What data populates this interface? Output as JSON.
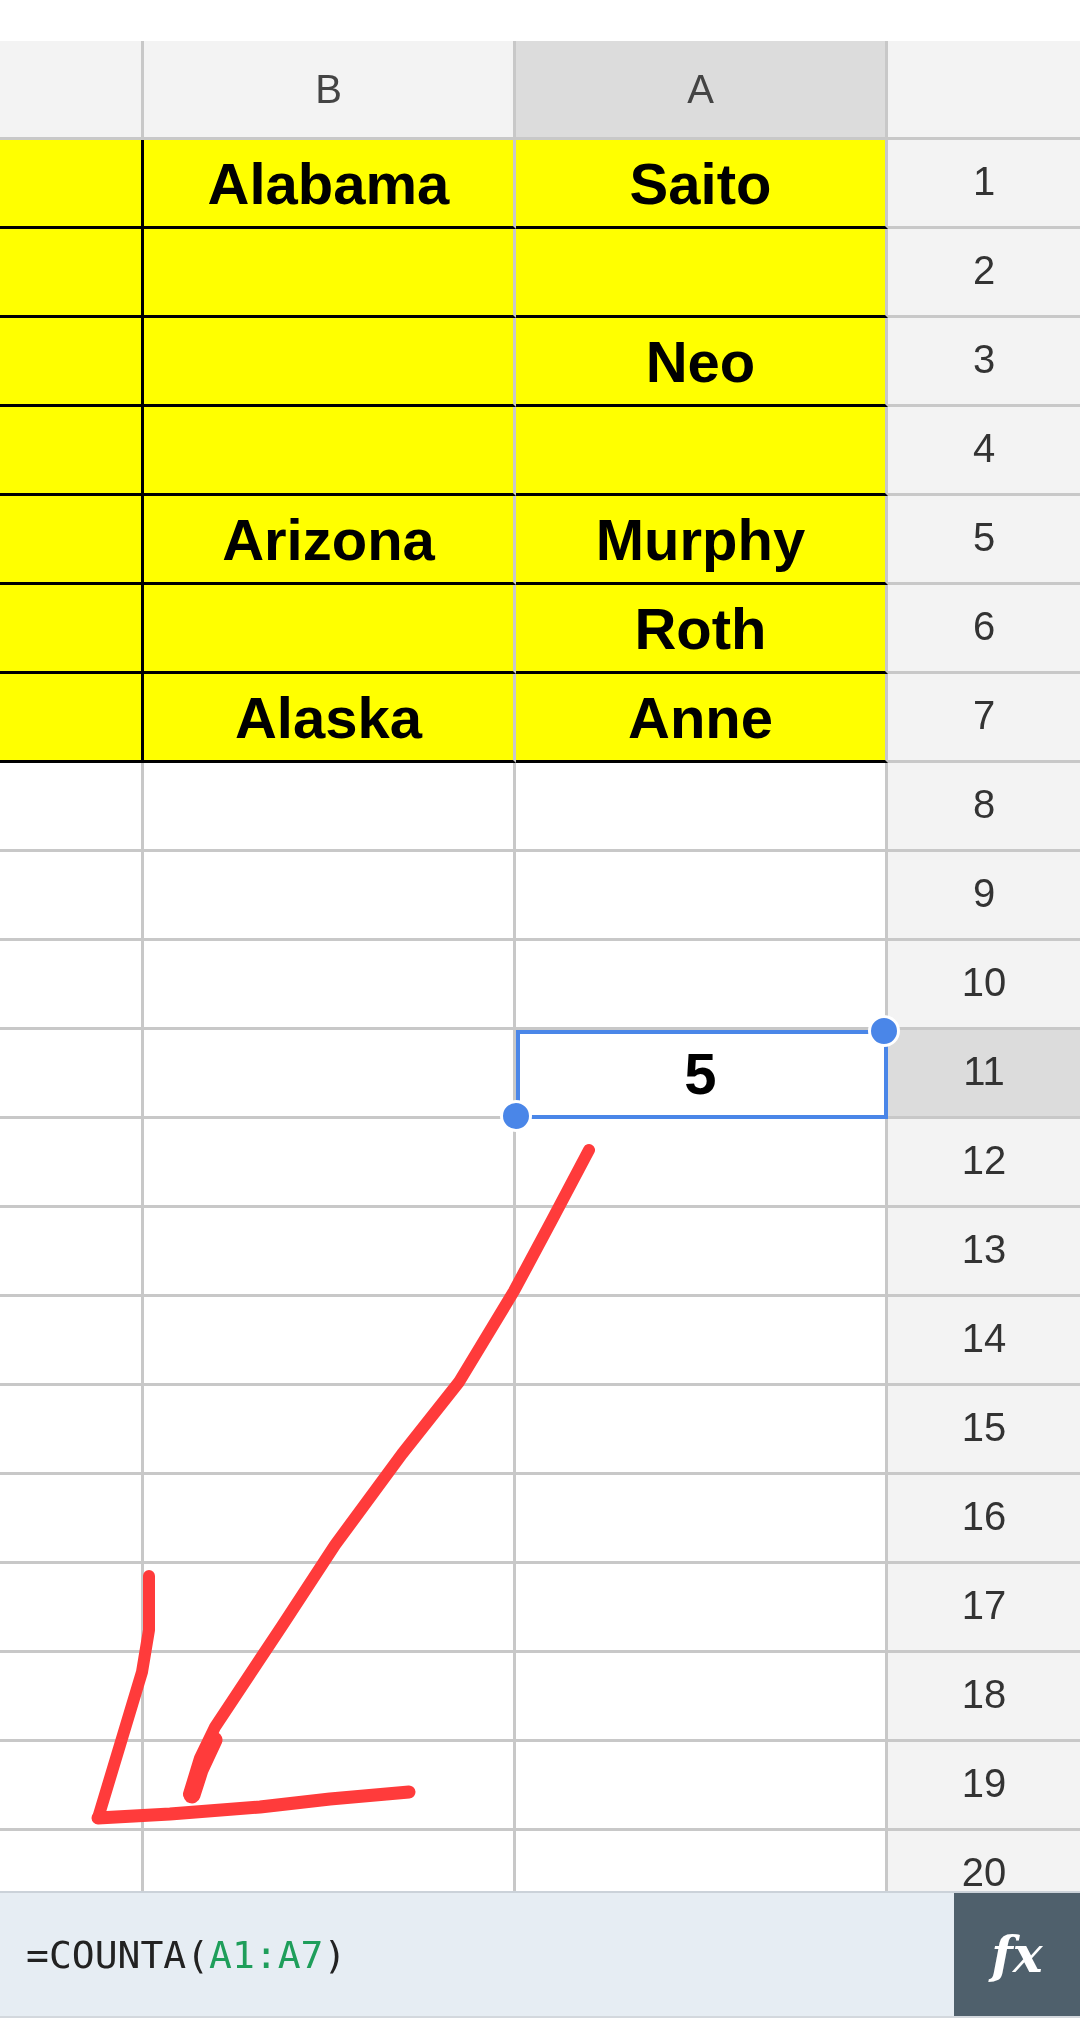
{
  "sheet": {
    "columns": [
      {
        "label": "B",
        "selected": false
      },
      {
        "label": "A",
        "selected": true
      }
    ],
    "rows": [
      {
        "number": "1",
        "highlighted": true,
        "selected": false,
        "b": "Alabama",
        "a": "Saito"
      },
      {
        "number": "2",
        "highlighted": true,
        "selected": false
      },
      {
        "number": "3",
        "highlighted": true,
        "selected": false,
        "a": "Neo"
      },
      {
        "number": "4",
        "highlighted": true,
        "selected": false
      },
      {
        "number": "5",
        "highlighted": true,
        "selected": false,
        "b": "Arizona",
        "a": "Murphy"
      },
      {
        "number": "6",
        "highlighted": true,
        "selected": false,
        "a": "Roth"
      },
      {
        "number": "7",
        "highlighted": true,
        "selected": false,
        "b": "Alaska",
        "a": "Anne"
      },
      {
        "number": "8",
        "highlighted": false,
        "selected": false
      },
      {
        "number": "9",
        "highlighted": false,
        "selected": false
      },
      {
        "number": "10",
        "highlighted": false,
        "selected": false
      },
      {
        "number": "11",
        "highlighted": false,
        "selected": true,
        "a": "5"
      },
      {
        "number": "12",
        "highlighted": false,
        "selected": false
      },
      {
        "number": "13",
        "highlighted": false,
        "selected": false
      },
      {
        "number": "14",
        "highlighted": false,
        "selected": false
      },
      {
        "number": "15",
        "highlighted": false,
        "selected": false
      },
      {
        "number": "16",
        "highlighted": false,
        "selected": false
      },
      {
        "number": "17",
        "highlighted": false,
        "selected": false
      },
      {
        "number": "18",
        "highlighted": false,
        "selected": false
      },
      {
        "number": "19",
        "highlighted": false,
        "selected": false
      },
      {
        "number": "20",
        "highlighted": false,
        "selected": false
      }
    ]
  },
  "annotations": [
    {
      "kind": "arrow"
    }
  ],
  "formula_bar": {
    "tokens": [
      {
        "kind": "plain",
        "text": "=COUNTA("
      },
      {
        "kind": "range",
        "text": "A1:A7",
        "color": "#1e9e5a"
      },
      {
        "kind": "plain",
        "text": ")"
      }
    ],
    "button": "fx"
  }
}
